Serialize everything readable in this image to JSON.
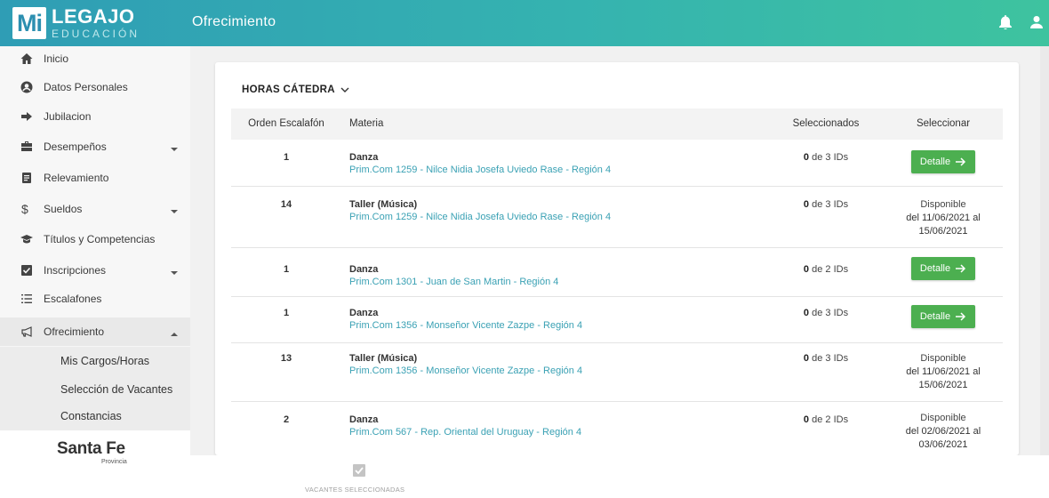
{
  "header": {
    "logo_mi": "Mi",
    "logo_title": "LEGAJO",
    "logo_subtitle": "EDUCACIÓN",
    "page_title": "Ofrecimiento",
    "bell_icon": "bell-icon",
    "user_icon": "user-icon"
  },
  "sidebar": {
    "items": [
      {
        "label": "Inicio",
        "icon": "home-icon"
      },
      {
        "label": "Datos Personales",
        "icon": "account-icon"
      },
      {
        "label": "Jubilacion",
        "icon": "arrow-right-icon"
      },
      {
        "label": "Desempeños",
        "icon": "briefcase-icon",
        "caret": "down"
      },
      {
        "label": "Relevamiento",
        "icon": "clipboard-icon"
      },
      {
        "label": "Sueldos",
        "icon": "dollar-icon",
        "caret": "down"
      },
      {
        "label": "Títulos y Competencias",
        "icon": "graduation-icon"
      },
      {
        "label": "Inscripciones",
        "icon": "checkbox-icon",
        "caret": "down"
      },
      {
        "label": "Escalafones",
        "icon": "list-icon"
      },
      {
        "label": "Ofrecimiento",
        "icon": "megaphone-icon",
        "caret": "up"
      }
    ],
    "sub_items": [
      {
        "label": "Mis Cargos/Horas"
      },
      {
        "label": "Selección de Vacantes"
      },
      {
        "label": "Constancias"
      }
    ],
    "footer_logo": "Santa Fe",
    "footer_sub": "Provincia"
  },
  "main": {
    "section_title": "HORAS CÁTEDRA",
    "columns": {
      "orden": "Orden Escalafón",
      "materia": "Materia",
      "seleccionados": "Seleccionados",
      "seleccionar": "Seleccionar"
    },
    "rows": [
      {
        "orden": "1",
        "materia": "Danza",
        "escuela": "Prim.Com 1259 - Nilce Nidia Josefa Uviedo Rase - Región 4",
        "sel_count": "0",
        "sel_text": "de 3 IDs",
        "action": "button",
        "button_label": "Detalle"
      },
      {
        "orden": "14",
        "materia": "Taller (Música)",
        "escuela": "Prim.Com 1259 - Nilce Nidia Josefa Uviedo Rase - Región 4",
        "sel_count": "0",
        "sel_text": "de 3 IDs",
        "action": "disponible",
        "disp_label": "Disponible",
        "disp_from": "del 11/06/2021 al",
        "disp_to": "15/06/2021"
      },
      {
        "orden": "1",
        "materia": "Danza",
        "escuela": "Prim.Com 1301 - Juan de San Martin - Región 4",
        "sel_count": "0",
        "sel_text": "de 2 IDs",
        "action": "button",
        "button_label": "Detalle"
      },
      {
        "orden": "1",
        "materia": "Danza",
        "escuela": "Prim.Com 1356 - Monseñor Vicente Zazpe - Región 4",
        "sel_count": "0",
        "sel_text": "de 3 IDs",
        "action": "button",
        "button_label": "Detalle"
      },
      {
        "orden": "13",
        "materia": "Taller (Música)",
        "escuela": "Prim.Com 1356 - Monseñor Vicente Zazpe - Región 4",
        "sel_count": "0",
        "sel_text": "de 3 IDs",
        "action": "disponible",
        "disp_label": "Disponible",
        "disp_from": "del 11/06/2021 al",
        "disp_to": "15/06/2021"
      },
      {
        "orden": "2",
        "materia": "Danza",
        "escuela": "Prim.Com 567 - Rep. Oriental del Uruguay - Región 4",
        "sel_count": "0",
        "sel_text": "de 2 IDs",
        "action": "disponible",
        "disp_label": "Disponible",
        "disp_from": "del 02/06/2021 al",
        "disp_to": "03/06/2021"
      }
    ]
  },
  "bottom_bar": {
    "vacantes_label": "VACANTES SELECCIONADAS",
    "vacantes_icon": "checkbox-checked-icon"
  },
  "colors": {
    "header_start": "#2f9db5",
    "header_end": "#3ec39f",
    "button_green": "#4caf50",
    "link_teal": "#3aa1b4"
  }
}
